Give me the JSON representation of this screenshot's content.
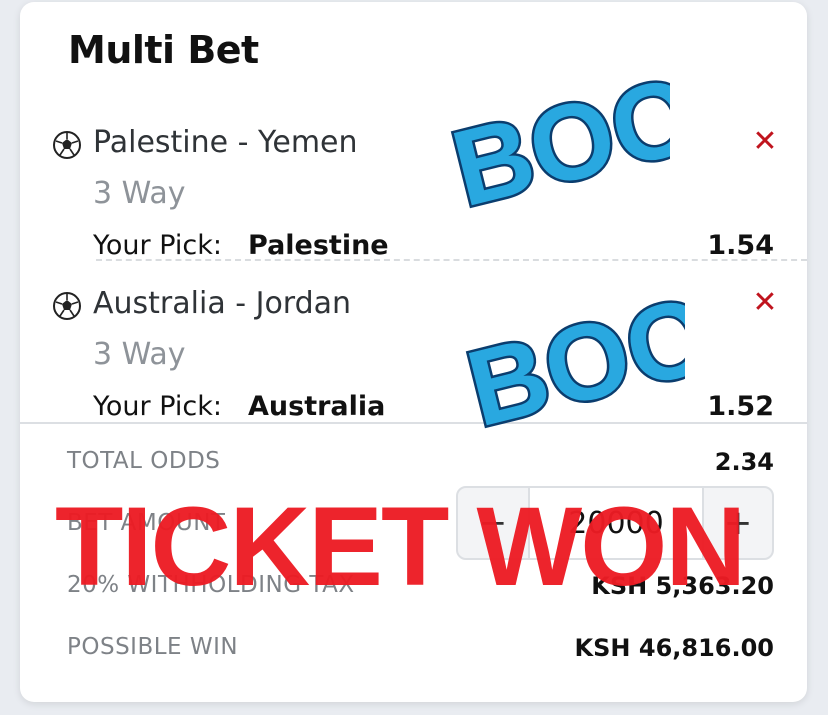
{
  "header": {
    "title": "Multi Bet"
  },
  "bets": [
    {
      "match": "Palestine - Yemen",
      "market": "3 Way",
      "pick_label": "Your Pick:",
      "pick": "Palestine",
      "odds": "1.54",
      "remove_icon": "close-icon"
    },
    {
      "match": "Australia - Jordan",
      "market": "3 Way",
      "pick_label": "Your Pick:",
      "pick": "Australia",
      "odds": "1.52",
      "remove_icon": "close-icon"
    }
  ],
  "summary": {
    "total_odds_label": "TOTAL ODDS",
    "total_odds_value": "2.34",
    "bet_amount_label": "BET AMOUNT",
    "bet_amount_value": "20000",
    "stepper_minus": "−",
    "stepper_plus": "+",
    "tax_label": "20% WITHHOLDING TAX",
    "tax_value": "KSH 5,363.20",
    "possible_win_label": "POSSIBLE WIN",
    "possible_win_value": "KSH 46,816.00"
  },
  "overlays": {
    "stamp_text": "TICKET WON",
    "sticker_text": "BOOM",
    "colors": {
      "stamp": "#ed1c24",
      "sticker_fill": "#29a8e0",
      "sticker_outline": "#0b3d6e"
    }
  }
}
